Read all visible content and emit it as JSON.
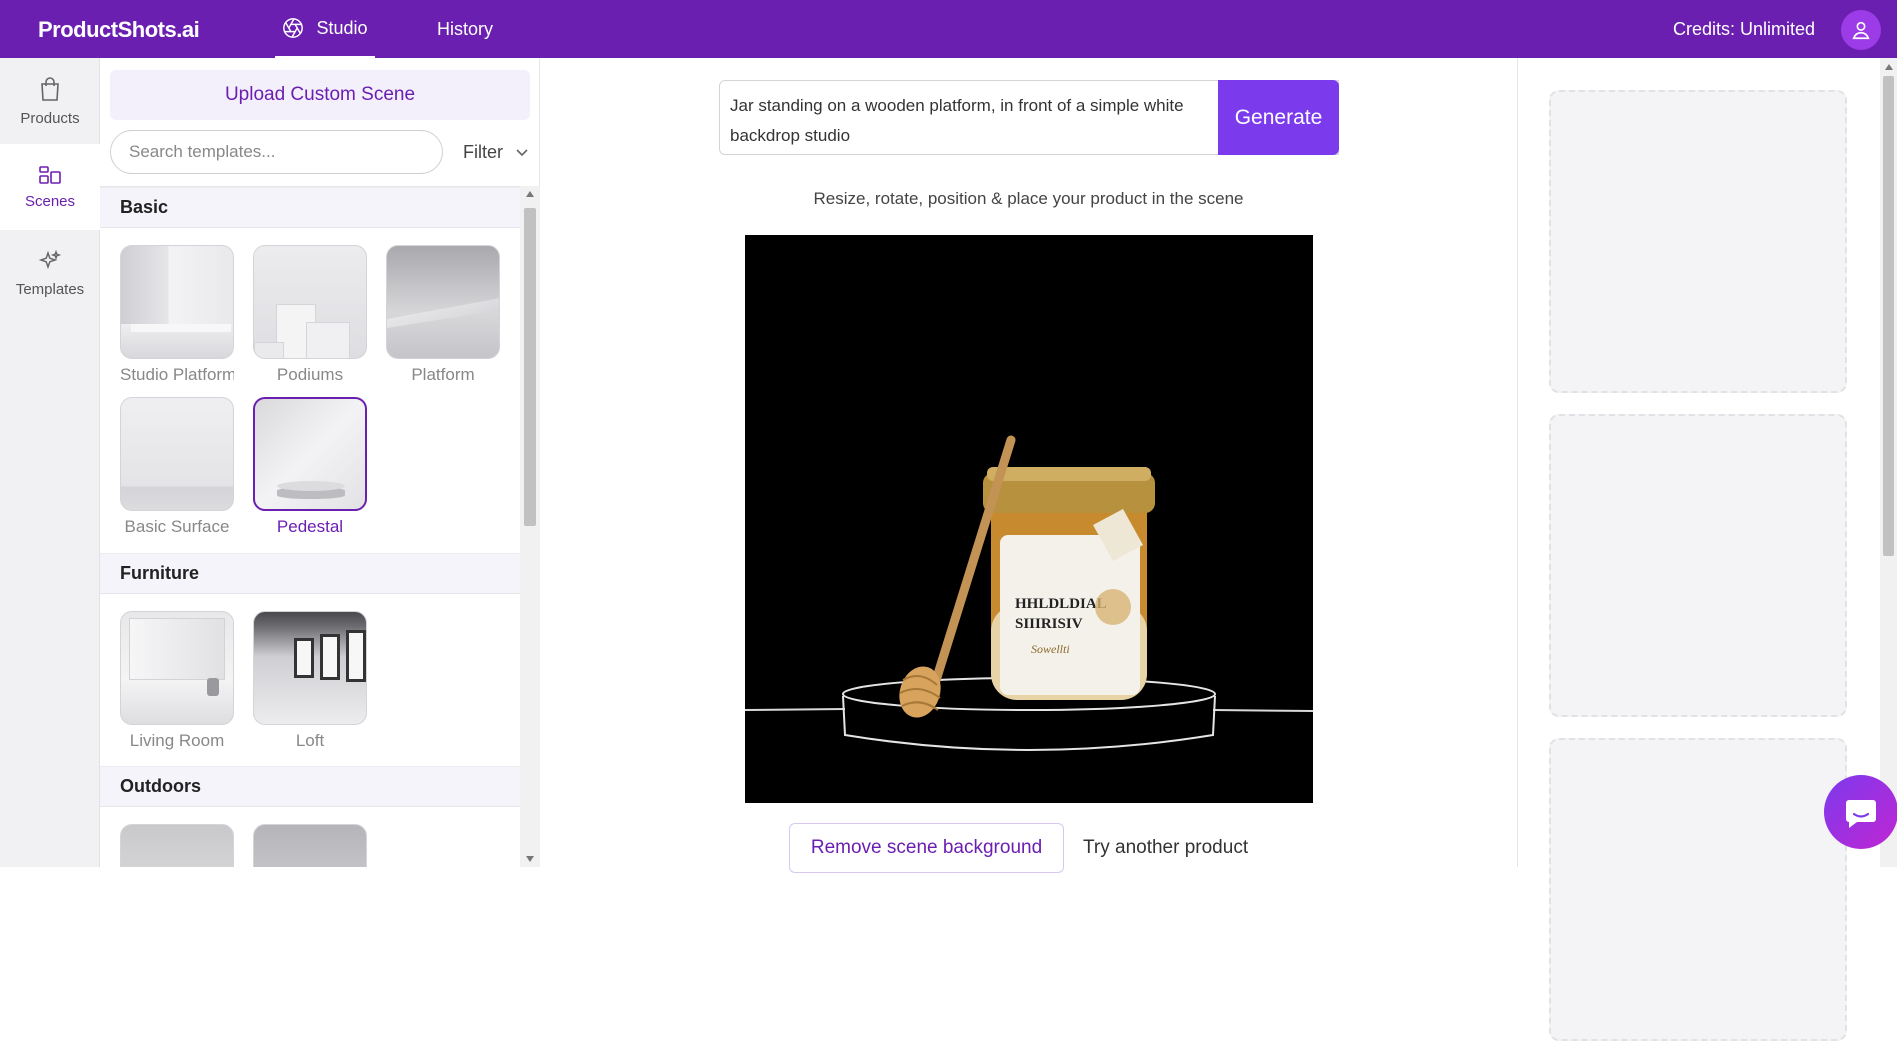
{
  "header": {
    "logo": "ProductShots.ai",
    "tabs": [
      {
        "label": "Studio",
        "active": true
      },
      {
        "label": "History",
        "active": false
      }
    ],
    "credits": "Credits: Unlimited"
  },
  "rail": {
    "items": [
      {
        "label": "Products",
        "icon": "shopping-bag-icon"
      },
      {
        "label": "Scenes",
        "icon": "layout-icon",
        "active": true
      },
      {
        "label": "Templates",
        "icon": "sparkles-icon"
      }
    ]
  },
  "panel": {
    "upload_label": "Upload Custom Scene",
    "search_placeholder": "Search templates...",
    "filter_label": "Filter",
    "sections": [
      {
        "title": "Basic",
        "items": [
          "Studio Platform",
          "Podiums",
          "Platform",
          "Basic Surface",
          "Pedestal"
        ]
      },
      {
        "title": "Furniture",
        "items": [
          "Living Room",
          "Loft"
        ]
      },
      {
        "title": "Outdoors",
        "items": []
      }
    ],
    "selected_item": "Pedestal"
  },
  "main": {
    "prompt": "Jar standing on a wooden platform, in front of a simple white backdrop studio",
    "generate_label": "Generate",
    "hint": "Resize, rotate, position & place your product in the scene",
    "remove_bg_label": "Remove scene background",
    "try_other_label": "Try another product"
  },
  "colors": {
    "brand": "#6b1fb0",
    "accent": "#7c3aed"
  }
}
